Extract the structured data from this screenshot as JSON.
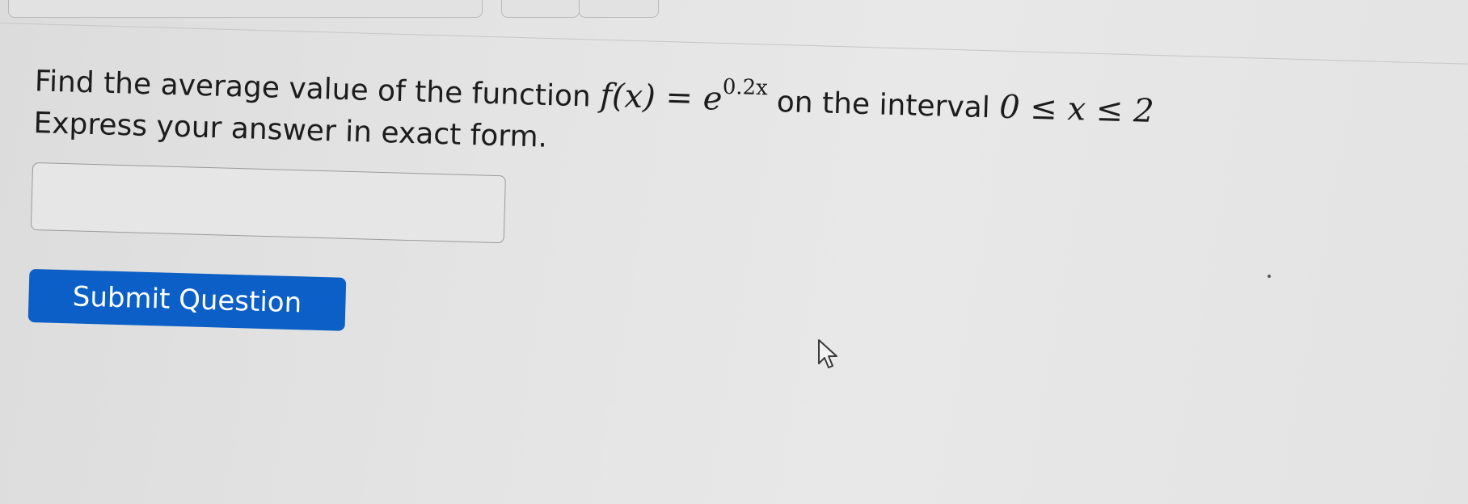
{
  "question": {
    "line1_text": "Find the average value of the function",
    "function_lhs": "f(x) = ",
    "function_base": "e",
    "function_exponent": "0.2x",
    "interval_text": "on the interval",
    "interval_math": "0 ≤ x ≤ 2",
    "line2_text": "Express your answer in exact form."
  },
  "answer": {
    "value": ""
  },
  "submit": {
    "label": "Submit Question"
  },
  "icons": {
    "cursor": "mouse-pointer-icon"
  },
  "colors": {
    "submit_background": "#0b5fc6",
    "submit_text": "#ffffff"
  }
}
